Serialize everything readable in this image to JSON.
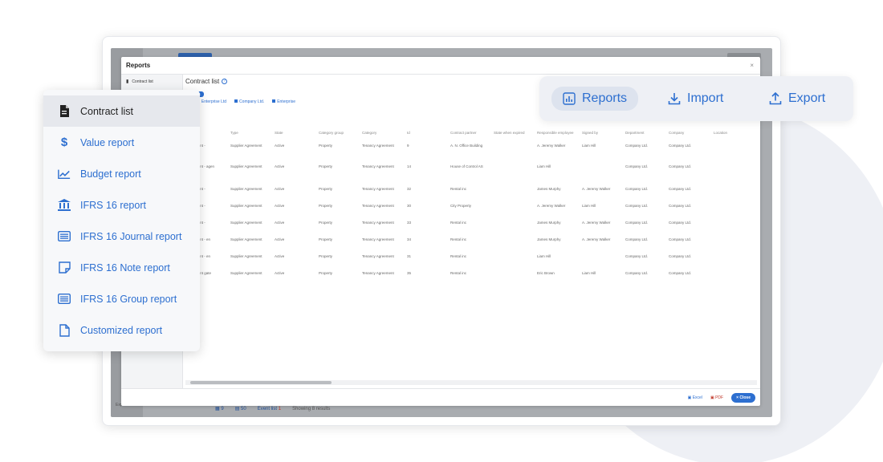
{
  "app": {
    "side_label": "Explore",
    "footer": {
      "item1": "9",
      "item2": "50",
      "event_list": "Event list",
      "event_count": "1",
      "showing": "Showing 8 results"
    }
  },
  "modal": {
    "title": "Reports",
    "close_x": "×",
    "sidebar": {
      "contract_list": "Contract list"
    },
    "content": {
      "heading": "Contract list",
      "help": "?",
      "chip": "Active",
      "tabs": [
        "al",
        "Enterprise Ltd",
        "Company Ltd.",
        "Enterprise"
      ]
    },
    "table": {
      "headers": [
        "Type",
        "State",
        "Category group",
        "Category",
        "Id",
        "Contract partner",
        "State when expired",
        "Responsible employee",
        "Signed by",
        "Department",
        "Company",
        "Location"
      ],
      "rows": [
        {
          "name": "Agreement -",
          "type": "Supplier Agreement",
          "state": "Active",
          "group": "Property",
          "category": "Tenancy Agreement",
          "id": "9",
          "partner": "A. N. Office Building",
          "responsible": "A. Jeremy Walker",
          "signed": "Liam Hill",
          "dept": "Company Ltd.",
          "company": "Company Ltd."
        },
        {
          "name": "Agreement - agen",
          "type": "Supplier Agreement",
          "state": "Active",
          "group": "Property",
          "category": "Tenancy Agreement",
          "id": "14",
          "partner": "House of Control AS",
          "responsible": "Liam Hill",
          "signed": "",
          "dept": "Company Ltd.",
          "company": "Company Ltd."
        },
        {
          "name": "Agreement -",
          "type": "Supplier Agreement",
          "state": "Active",
          "group": "Property",
          "category": "Tenancy Agreement",
          "id": "32",
          "partner": "Rental inc",
          "responsible": "James Murphy",
          "signed": "A. Jeremy Walker",
          "dept": "Company Ltd.",
          "company": "Company Ltd."
        },
        {
          "name": "Agreement -",
          "type": "Supplier Agreement",
          "state": "Active",
          "group": "Property",
          "category": "Tenancy Agreement",
          "id": "30",
          "partner": "City Property",
          "responsible": "A. Jeremy Walker",
          "signed": "Liam Hill",
          "dept": "Company Ltd.",
          "company": "Company Ltd."
        },
        {
          "name": "Agreement -",
          "type": "Supplier Agreement",
          "state": "Active",
          "group": "Property",
          "category": "Tenancy Agreement",
          "id": "33",
          "partner": "Rental inc",
          "responsible": "James Murphy",
          "signed": "A. Jeremy Walker",
          "dept": "Company Ltd.",
          "company": "Company Ltd."
        },
        {
          "name": "Agreement - en",
          "type": "Supplier Agreement",
          "state": "Active",
          "group": "Property",
          "category": "Tenancy Agreement",
          "id": "34",
          "partner": "Rental inc",
          "responsible": "James Murphy",
          "signed": "A. Jeremy Walker",
          "dept": "Company Ltd.",
          "company": "Company Ltd."
        },
        {
          "name": "Agreement - en",
          "type": "Supplier Agreement",
          "state": "Active",
          "group": "Property",
          "category": "Tenancy Agreement",
          "id": "31",
          "partner": "Rental inc",
          "responsible": "Liam Hill",
          "signed": "",
          "dept": "Company Ltd.",
          "company": "Company Ltd."
        },
        {
          "name": "Agreement gate",
          "type": "Supplier Agreement",
          "state": "Active",
          "group": "Property",
          "category": "Tenancy Agreement",
          "id": "35",
          "partner": "Rental inc",
          "responsible": "Eric Brown",
          "signed": "Liam Hill",
          "dept": "Company Ltd.",
          "company": "Company Ltd."
        }
      ]
    },
    "footer": {
      "excel": "Excel",
      "pdf": "PDF",
      "close": "× Close"
    }
  },
  "menu": {
    "items": [
      {
        "label": "Contract list",
        "icon": "document-icon"
      },
      {
        "label": "Value report",
        "icon": "dollar-icon"
      },
      {
        "label": "Budget report",
        "icon": "line-chart-icon"
      },
      {
        "label": "IFRS 16 report",
        "icon": "bank-icon"
      },
      {
        "label": "IFRS 16 Journal report",
        "icon": "list-icon"
      },
      {
        "label": "IFRS 16 Note report",
        "icon": "note-icon"
      },
      {
        "label": "IFRS 16 Group report",
        "icon": "list-icon"
      },
      {
        "label": "Customized report",
        "icon": "file-icon"
      }
    ]
  },
  "toolbar": {
    "reports": "Reports",
    "import": "Import",
    "export": "Export"
  },
  "colors": {
    "accent": "#2d6fd0",
    "active_bg": "#e6e8ed"
  }
}
